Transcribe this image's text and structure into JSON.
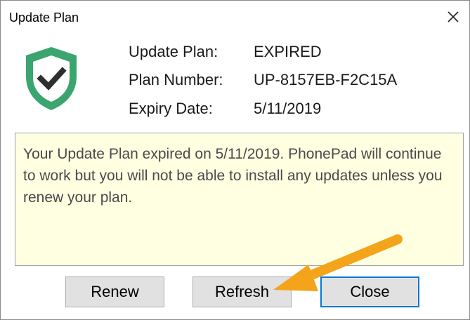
{
  "window": {
    "title": "Update Plan",
    "close_glyph": "✕"
  },
  "plan_info": {
    "rows": [
      {
        "label": "Update Plan:",
        "value": "EXPIRED"
      },
      {
        "label": "Plan Number:",
        "value": "UP-8157EB-F2C15A"
      },
      {
        "label": "Expiry Date:",
        "value": "5/11/2019"
      }
    ]
  },
  "message": "Your Update Plan expired on 5/11/2019. PhonePad will continue to work but you will not be able to install any updates unless you renew your plan.",
  "buttons": {
    "renew": "Renew",
    "refresh": "Refresh",
    "close": "Close"
  },
  "icons": {
    "shield": "shield-check-icon",
    "arrow": "arrow-annotation"
  },
  "colors": {
    "shield_green": "#3aa56e",
    "check_dark": "#2f2f2f",
    "message_background": "#ffffe1",
    "arrow_orange": "#f3a41b",
    "default_button_border": "#0078d7"
  }
}
